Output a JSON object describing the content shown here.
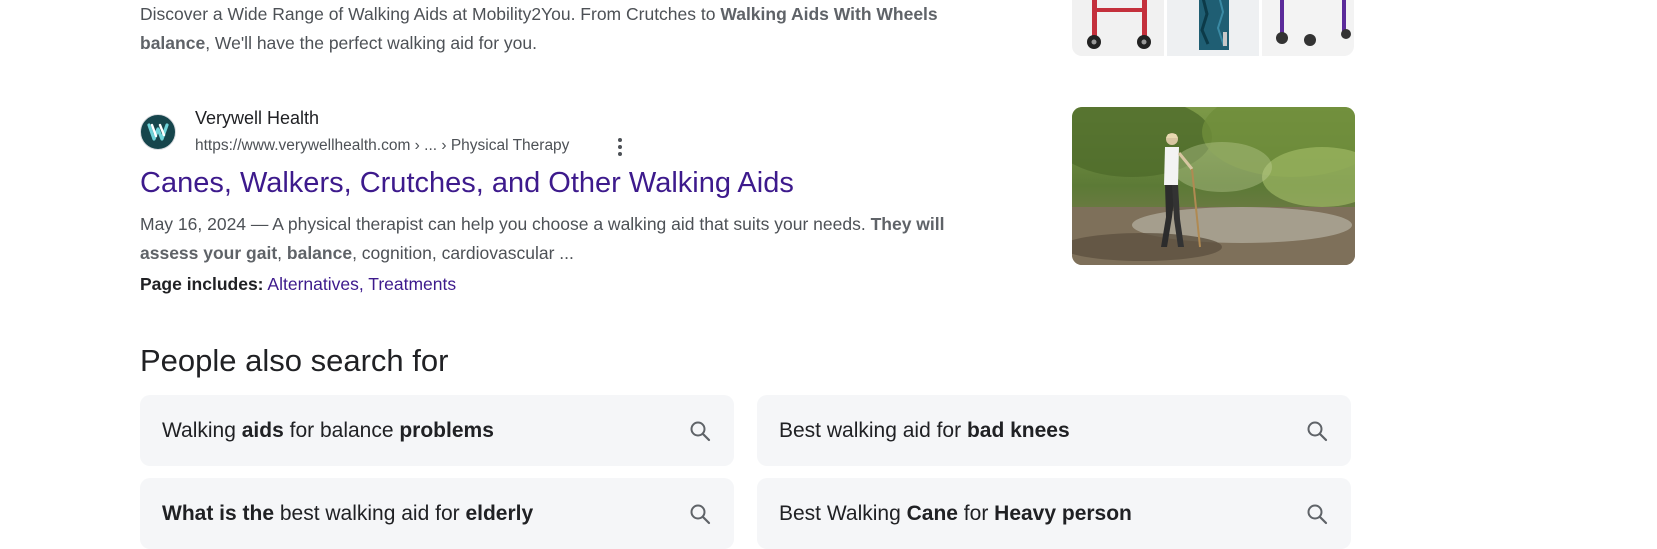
{
  "results": [
    {
      "snippet_parts": [
        {
          "t": "Discover a Wide Range of Walking Aids at Mobility2You. From Crutches to ",
          "b": false
        },
        {
          "t": "Walking Aids With Wheels balance",
          "b": true
        },
        {
          "t": ", We'll have the perfect walking aid for you.",
          "b": false
        }
      ]
    },
    {
      "site_name": "Verywell Health",
      "url": "https://www.verywellhealth.com › ... › Physical Therapy",
      "title": "Canes, Walkers, Crutches, and Other Walking Aids",
      "snippet_parts": [
        {
          "t": "May 16, 2024 — A physical therapist can help you choose a walking aid that suits your needs. ",
          "b": false
        },
        {
          "t": "They will assess your gait",
          "b": true
        },
        {
          "t": ", ",
          "b": false
        },
        {
          "t": "balance",
          "b": true
        },
        {
          "t": ", cognition, cardiovascular ...",
          "b": false
        }
      ],
      "page_includes_label": "Page includes:",
      "page_includes_links": [
        "Alternatives",
        "Treatments"
      ],
      "page_includes_sep": ", "
    }
  ],
  "people_also_search": {
    "heading": "People also search for",
    "chips": [
      [
        {
          "t": "Walking ",
          "b": false
        },
        {
          "t": "aids",
          "b": true
        },
        {
          "t": " for balance ",
          "b": false
        },
        {
          "t": "problems",
          "b": true
        }
      ],
      [
        {
          "t": "Best walking aid for ",
          "b": false
        },
        {
          "t": "bad knees",
          "b": true
        }
      ],
      [
        {
          "t": "What is the",
          "b": true
        },
        {
          "t": " best walking aid for ",
          "b": false
        },
        {
          "t": "elderly",
          "b": true
        }
      ],
      [
        {
          "t": "Best Walking ",
          "b": false
        },
        {
          "t": "Cane",
          "b": true
        },
        {
          "t": " for ",
          "b": false
        },
        {
          "t": "Heavy person",
          "b": true
        }
      ]
    ]
  },
  "colors": {
    "link_visited": "#3d1a8c",
    "snippet": "#4d5156",
    "chip_bg": "#f5f6f8"
  },
  "icons": [
    "verywell-favicon-icon",
    "more-options-icon",
    "search-icon"
  ]
}
